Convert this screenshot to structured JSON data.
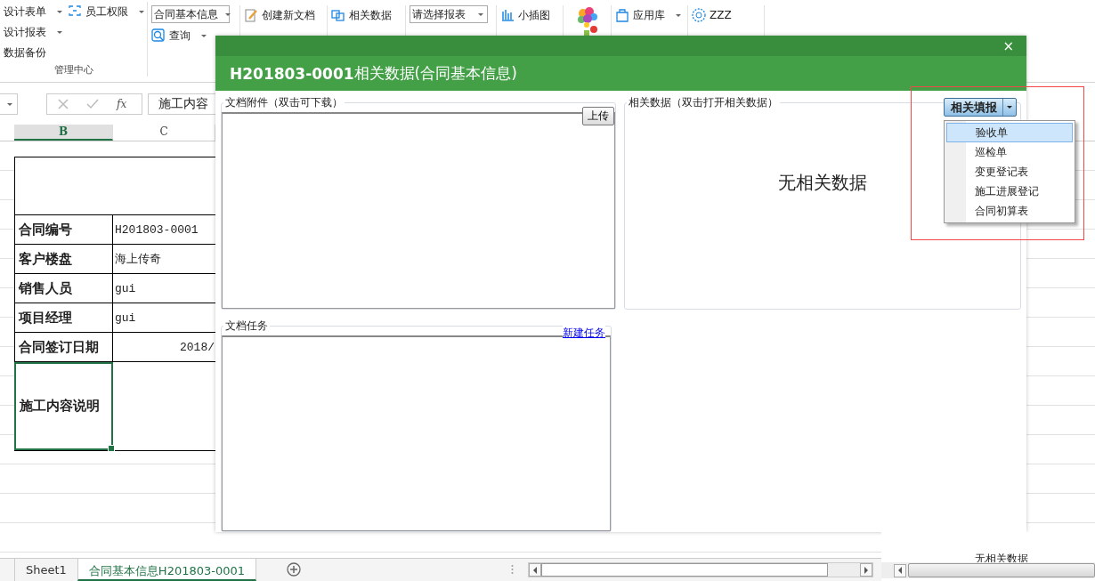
{
  "ribbon": {
    "groups": [
      {
        "caption": "管理中心",
        "columns": [
          [
            {
              "label": "设计表单",
              "kind": "menu"
            },
            {
              "label": "设计报表",
              "kind": "menu"
            },
            {
              "label": "数据备份",
              "kind": "button"
            }
          ],
          [
            {
              "label": "员工权限",
              "kind": "menu"
            }
          ]
        ]
      },
      {
        "columns": [
          [
            {
              "label": "合同基本信息",
              "kind": "combo"
            },
            {
              "label": "查询",
              "kind": "menu"
            }
          ]
        ]
      },
      {
        "columns": [
          [
            {
              "label": "创建新文档",
              "kind": "button"
            }
          ]
        ]
      },
      {
        "columns": [
          [
            {
              "label": "相关数据",
              "kind": "button"
            }
          ]
        ]
      },
      {
        "columns": [
          [
            {
              "label": "请选择报表",
              "kind": "combo"
            }
          ]
        ]
      },
      {
        "columns": [
          [
            {
              "label": "小插图",
              "kind": "button"
            }
          ]
        ]
      },
      {
        "columns": [
          [
            {
              "kind": "art"
            }
          ]
        ]
      },
      {
        "columns": [
          [
            {
              "label": "应用库",
              "kind": "menu"
            }
          ]
        ]
      },
      {
        "columns": [
          [
            {
              "label": "ZZZ",
              "kind": "button"
            }
          ]
        ]
      }
    ]
  },
  "formula_bar": {
    "function_icon": "fx",
    "value": "施工内容"
  },
  "sheet": {
    "columns": [
      {
        "label": "B",
        "selected": true
      },
      {
        "label": "C",
        "selected": false
      }
    ],
    "rows": [
      {
        "field": "合同编号",
        "value": "H201803-0001",
        "kind": "text",
        "selected": false
      },
      {
        "field": "客户楼盘",
        "value": "海上传奇",
        "kind": "text",
        "selected": false
      },
      {
        "field": "销售人员",
        "value": "gui",
        "kind": "text",
        "selected": false
      },
      {
        "field": "项目经理",
        "value": "gui",
        "kind": "text",
        "selected": false
      },
      {
        "field": "合同签订日期",
        "value": "2018/",
        "kind": "date",
        "selected": false
      },
      {
        "field": "施工内容说明",
        "kind": "tall",
        "selected": true
      }
    ]
  },
  "sheet_tabs": [
    {
      "label": "Sheet1",
      "selected": false
    },
    {
      "label": "合同基本信息H201803-0001",
      "selected": true
    }
  ],
  "dialog": {
    "close": "×",
    "title": "**H201803-0001**相关数据(合同基本信息)",
    "attachments": {
      "label": "文档附件（双击可下载）",
      "upload": "上传"
    },
    "related": {
      "label": "相关数据（双击打开相关数据）",
      "empty_text": "无相关数据"
    },
    "tasks": {
      "label": "文档任务",
      "new_link": "新建任务"
    }
  },
  "fill_menu": {
    "button": "相关填报",
    "items": [
      {
        "label": "验收单",
        "selected": true
      },
      {
        "label": "巡检单",
        "selected": false
      },
      {
        "label": "变更登记表",
        "selected": false
      },
      {
        "label": "施工进展登记",
        "selected": false
      },
      {
        "label": "合同初算表",
        "selected": false
      }
    ]
  },
  "background_panel": {
    "text": "无相关数据"
  }
}
